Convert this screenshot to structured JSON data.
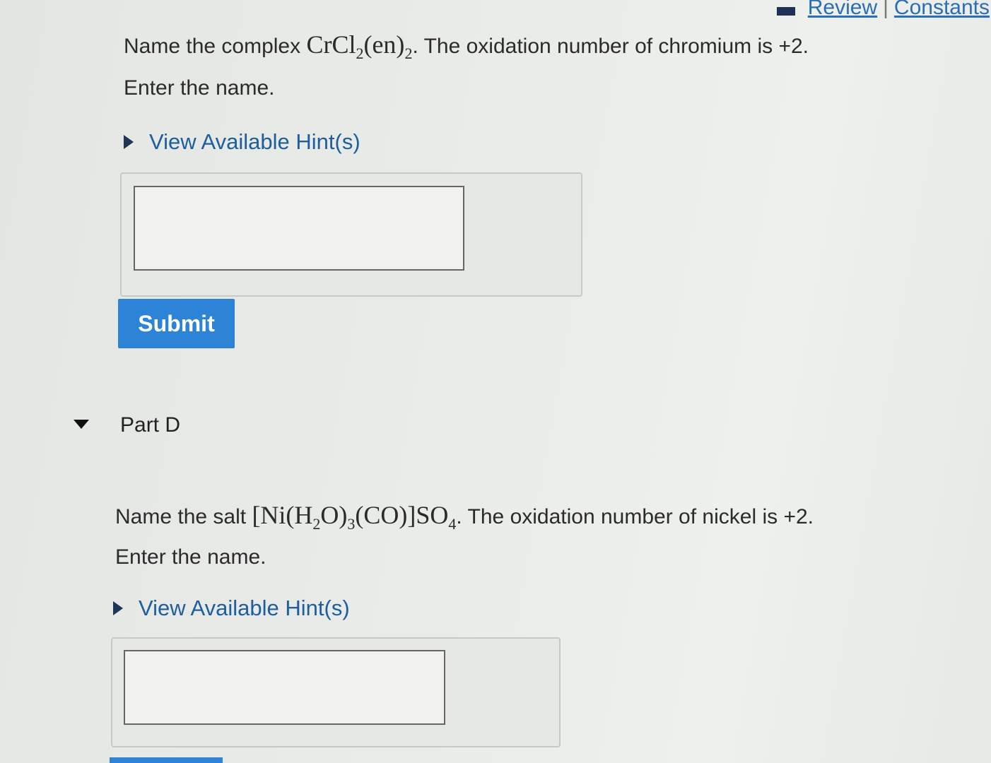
{
  "header": {
    "review_label": "Review",
    "separator": "|",
    "constants_label": "Constants"
  },
  "part_c": {
    "prompt_prefix": "Name the complex",
    "formula": {
      "a": "CrCl",
      "b": "2",
      "c": "(en)",
      "d": "2"
    },
    "prompt_suffix": ". The oxidation number of chromium is +2.",
    "instruction": "Enter the name.",
    "hint_label": "View Available Hint(s)",
    "answer_value": "",
    "submit_label": "Submit"
  },
  "part_d": {
    "title": "Part D",
    "prompt_prefix": "Name the salt",
    "formula": {
      "a": "[Ni(H",
      "b": "2",
      "c": "O)",
      "d": "3",
      "e": "(CO)]SO",
      "f": "4"
    },
    "prompt_suffix": ". The oxidation number of nickel is +2.",
    "instruction": "Enter the name.",
    "hint_label": "View Available Hint(s)",
    "answer_value": ""
  }
}
